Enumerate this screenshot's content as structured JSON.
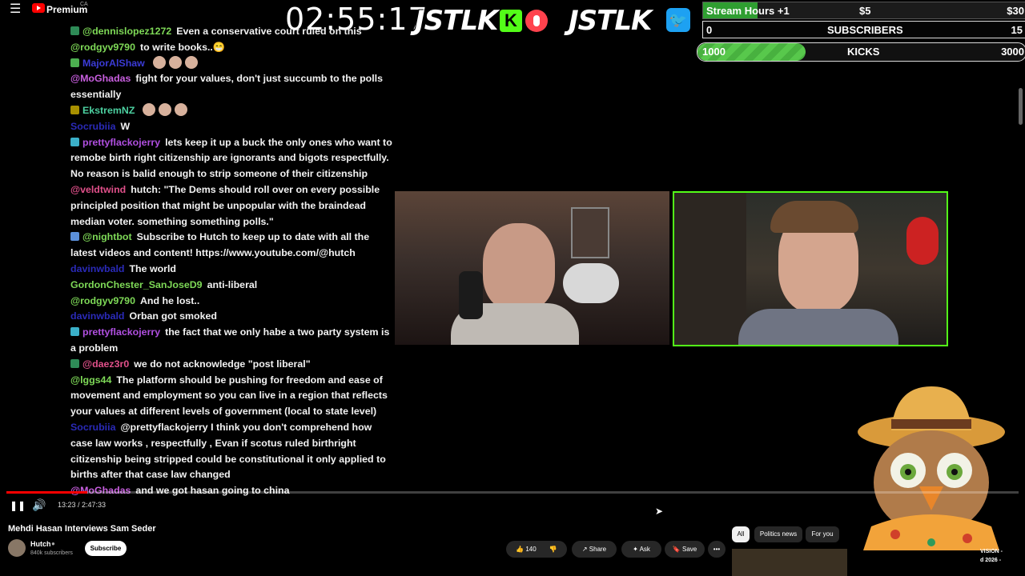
{
  "topbar": {
    "brand": "Premium",
    "country": "CA",
    "stream_time": "02:55:17",
    "logo_text_1": "JSTLK",
    "logo_text_2": "JSTLK",
    "kick_letter": "K",
    "twitter_glyph": "🐦"
  },
  "goals": {
    "hours": {
      "label": "Stream Hours +1",
      "mid": "$5",
      "end": "$30"
    },
    "subscribers": {
      "current": "0",
      "label": "SUBSCRIBERS",
      "target": "15"
    },
    "kicks": {
      "current": "1000",
      "label": "KICKS",
      "target": "3000",
      "progress": 0.33
    }
  },
  "chat": [
    {
      "user": "@dennislopez1272",
      "color": "#7ed957",
      "badge": "#2e8b57",
      "text": "Even a conservative court ruled on this"
    },
    {
      "user": "@rodgyv9790",
      "color": "#7ed957",
      "text": "to write books..😁"
    },
    {
      "user": "MajorAlShaw",
      "color": "#3b3bd6",
      "badge": "#4caf50",
      "text": "",
      "emotes": 3
    },
    {
      "user": "@MoGhadas",
      "color": "#c95fe0",
      "text": "fight for your values, don't just succumb to the polls essentially"
    },
    {
      "user": "EkstremNZ",
      "color": "#4cd0a0",
      "badge": "#a89000",
      "text": "",
      "emotes": 3
    },
    {
      "user": "Socrubiia",
      "color": "#2a2ab8",
      "text": "W"
    },
    {
      "user": "prettyflackojerry",
      "color": "#b04fe0",
      "badge": "#3bb0c9",
      "text": "lets keep it up a buck the only ones who want to remobe birth right citizenship are ignorants and bigots respectfully. No reason is balid enough to strip someone of their citizenship"
    },
    {
      "user": "@veldtwind",
      "color": "#e0508a",
      "text": "hutch: \"The Dems should roll over on every possible principled position that might be unpopular with the braindead median voter. something something polls.\""
    },
    {
      "user": "@nightbot",
      "color": "#7ed957",
      "badge": "#5b8fd9",
      "text": "Subscribe to Hutch to keep up to date with all the latest videos and content! https://www.youtube.com/@hutch"
    },
    {
      "user": "davinwbald",
      "color": "#2a2ab8",
      "text": "The world"
    },
    {
      "user": "GordonChester_SanJoseD9",
      "color": "#7ed957",
      "text": "anti-liberal"
    },
    {
      "user": "@rodgyv9790",
      "color": "#7ed957",
      "text": "And he lost.."
    },
    {
      "user": "davinwbald",
      "color": "#2a2ab8",
      "text": "Orban got smoked"
    },
    {
      "user": "prettyflackojerry",
      "color": "#b04fe0",
      "badge": "#3bb0c9",
      "text": "the fact that we only habe a two party system is a problem"
    },
    {
      "user": "@daez3r0",
      "color": "#e0508a",
      "badge": "#2e8b57",
      "text": "we do not acknowledge \"post liberal\""
    },
    {
      "user": "@lggs44",
      "color": "#7ed957",
      "text": "The platform should be pushing for freedom and ease of movement and employment so you can live in a region that reflects your values at different levels of government (local to state level)"
    },
    {
      "user": "Socrubiia",
      "color": "#2a2ab8",
      "text": "@prettyflackojerry I think you don't comprehend how case law works , respectfully , Evan if scotus ruled birthright citizenship being stripped could be constitutional it only applied to births after that case law changed"
    },
    {
      "user": "@MoGhadas",
      "color": "#c95fe0",
      "text": "and we got hasan going to china"
    }
  ],
  "player": {
    "time": "13:23 / 2:47:33",
    "progress": 0.08
  },
  "video": {
    "title": "Mehdi Hasan Interviews Sam Seder",
    "channel": "Hutch",
    "subscribers": "840k subscribers",
    "subscribe_label": "Subscribe",
    "likes": "140",
    "share_label": "Share",
    "ask_label": "Ask",
    "save_label": "Save",
    "more_label": "•••"
  },
  "filters": {
    "all": "All",
    "politics": "Politics news",
    "foryou": "For you"
  },
  "recommended": {
    "line1": "VISION -",
    "line2": "d 2026 -"
  },
  "colors": {
    "accent_green": "#53fc18",
    "progress_red": "#ff0000"
  }
}
